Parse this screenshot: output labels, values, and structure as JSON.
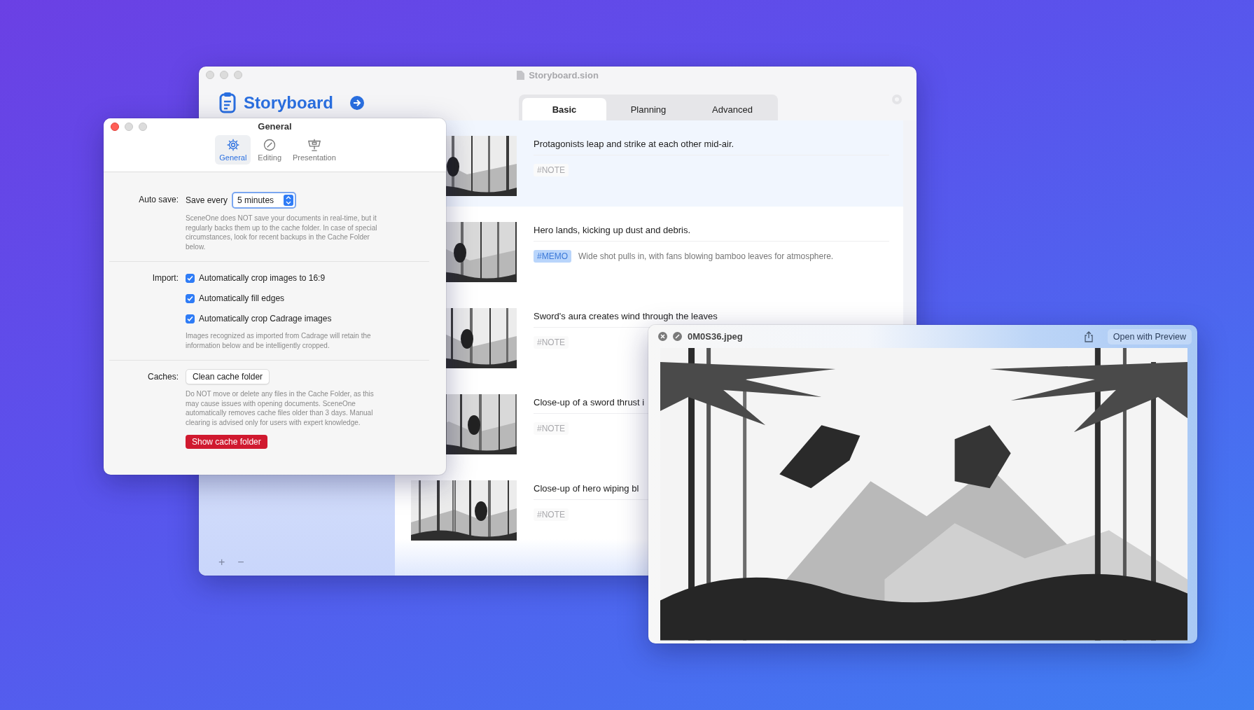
{
  "main_window": {
    "title": "Storyboard.sion",
    "app_name": "Storyboard",
    "tabs": [
      {
        "label": "Basic",
        "selected": true
      },
      {
        "label": "Planning",
        "selected": false
      },
      {
        "label": "Advanced",
        "selected": false
      }
    ],
    "scenes": [
      {
        "description": "Protagonists leap and strike at each other mid-air.",
        "tag": {
          "kind": "note",
          "label": "#NOTE"
        },
        "selected": true
      },
      {
        "description": "Hero lands, kicking up dust and debris.",
        "tag": {
          "kind": "memo",
          "label": "#MEMO"
        },
        "note": "Wide shot pulls in, with fans blowing bamboo leaves for atmosphere.",
        "selected": false
      },
      {
        "description": "Sword's aura creates wind through the leaves",
        "tag": {
          "kind": "note",
          "label": "#NOTE"
        },
        "selected": false
      },
      {
        "description": "Close-up of a sword thrust i",
        "tag": {
          "kind": "note",
          "label": "#NOTE"
        },
        "selected": false
      },
      {
        "description": "Close-up of hero wiping bl",
        "tag": {
          "kind": "note",
          "label": "#NOTE"
        },
        "selected": false
      }
    ],
    "sidebar_buttons": [
      "+",
      "−"
    ]
  },
  "preferences": {
    "title": "General",
    "toolbar": [
      {
        "label": "General",
        "selected": true
      },
      {
        "label": "Editing",
        "selected": false
      },
      {
        "label": "Presentation",
        "selected": false
      }
    ],
    "sections": [
      {
        "kind": "select",
        "label": "Auto save:",
        "prefix": "Save every",
        "value": "5 minutes",
        "help": "SceneOne does NOT save your documents in real-time, but it regularly backs them up to the cache folder. In case of special circumstances, look for recent backups in the Cache Folder below."
      },
      {
        "kind": "checkboxes",
        "label": "Import:",
        "options": [
          {
            "label": "Automatically crop images to 16:9",
            "checked": true
          },
          {
            "label": "Automatically fill edges",
            "checked": true
          },
          {
            "label": "Automatically crop Cadrage images",
            "checked": true
          }
        ],
        "help": "Images recognized as imported from Cadrage will retain the information below and be intelligently cropped."
      },
      {
        "kind": "buttons",
        "label": "Caches:",
        "button": "Clean cache folder",
        "help": "Do NOT move or delete any files in the Cache Folder, as this may cause issues with opening documents. SceneOne automatically removes cache files older than 3 days. Manual clearing is advised only for users with expert knowledge.",
        "action": "Show cache folder"
      }
    ]
  },
  "preview": {
    "title": "0M0S36.jpeg",
    "open_button": "Open with Preview"
  }
}
